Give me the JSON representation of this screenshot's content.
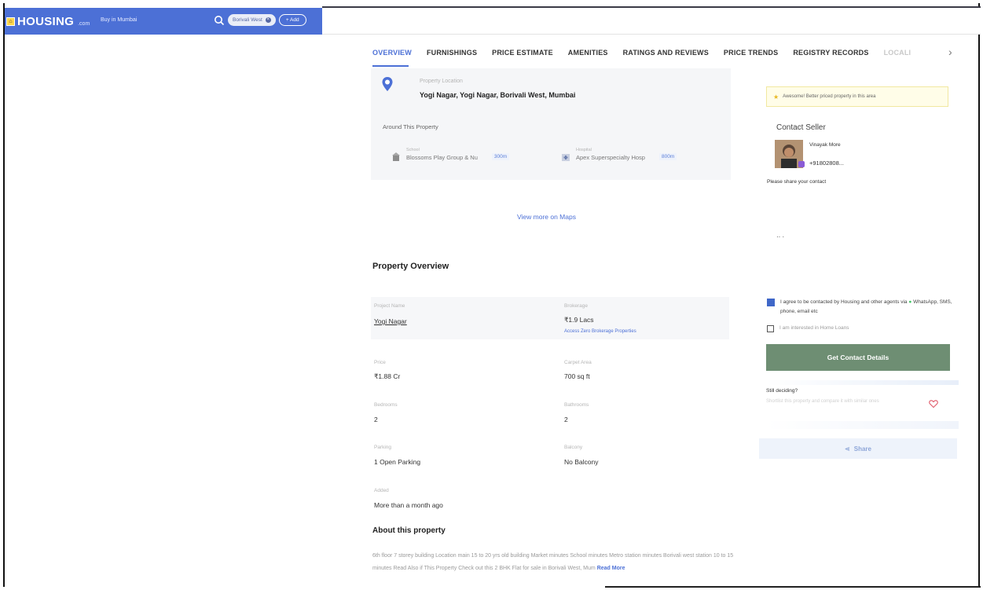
{
  "header": {
    "logo_text": "HOUSING",
    "logo_sub": ".com",
    "city": "Buy in Mumbai",
    "search_chip": "Borivali West",
    "add_label": "+ Add"
  },
  "tabs": [
    {
      "label": "OVERVIEW"
    },
    {
      "label": "FURNISHINGS"
    },
    {
      "label": "PRICE ESTIMATE"
    },
    {
      "label": "AMENITIES"
    },
    {
      "label": "RATINGS AND REVIEWS"
    },
    {
      "label": "PRICE TRENDS"
    },
    {
      "label": "REGISTRY RECORDS"
    },
    {
      "label": "LOCALI"
    }
  ],
  "location": {
    "label": "Property Location",
    "value": "Yogi Nagar, Yogi Nagar, Borivali West, Mumbai",
    "around_label": "Around This Property",
    "pois": [
      {
        "type": "School",
        "name": "Blossoms Play Group & Nu",
        "distance": "300m"
      },
      {
        "type": "Hospital",
        "name": "Apex Superspecialty Hosp",
        "distance": "800m"
      }
    ],
    "view_maps": "View more on Maps"
  },
  "overview": {
    "title": "Property Overview",
    "fields": {
      "project_name_label": "Project Name",
      "project_name": "Yogi Nagar",
      "brokerage_label": "Brokerage",
      "brokerage": "₹1.9 Lacs",
      "brokerage_link": "Access Zero Brokerage Properties",
      "price_label": "Price",
      "price": "₹1.88 Cr",
      "carpet_label": "Carpet Area",
      "carpet": "700 sq ft",
      "bedrooms_label": "Bedrooms",
      "bedrooms": "2",
      "bathrooms_label": "Bathrooms",
      "bathrooms": "2",
      "parking_label": "Parking",
      "parking": "1 Open Parking",
      "balcony_label": "Balcony",
      "balcony": "No Balcony",
      "added_label": "Added",
      "added": "More than a month ago"
    }
  },
  "about": {
    "title": "About this property",
    "text": "6th floor 7 storey building Location main 15 to 20 yrs old building Market minutes School minutes Metro station minutes Borivali west station 10 to 15 minutes Read Also if This Property Check out this 2 BHK Flat for sale in Borivali West, Mum",
    "read_more": "Read More"
  },
  "sidebar": {
    "promo": "Awesome! Better priced property in this area",
    "contact_title": "Contact Seller",
    "seller_name": "Vinayak More",
    "seller_phone": "+91802808...",
    "share_details": "Please share your contact",
    "dots": "·· ·",
    "agree_text_1": "I agree to be contacted by Housing and other agents via ",
    "agree_text_2": " WhatsApp, SMS, phone, email etc",
    "home_loan": "I am interested in Home Loans",
    "cta": "Get Contact Details",
    "still_deciding": "Still deciding?",
    "still_sub": "Shortlist this property and compare it with similar ones",
    "share": "Share"
  },
  "colors": {
    "brand": "#4c70d6",
    "cta": "#6e8e73",
    "promo_bg": "#fffde8"
  }
}
